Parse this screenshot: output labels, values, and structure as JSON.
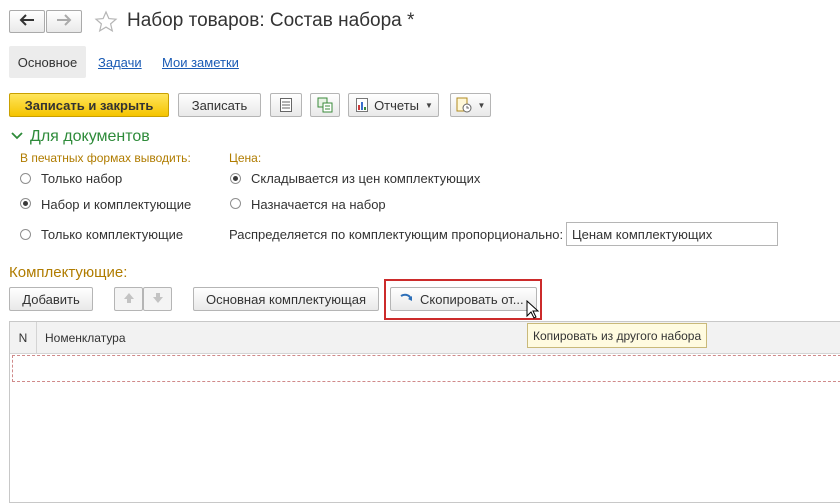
{
  "window": {
    "title": "Набор товаров: Состав набора *"
  },
  "nav": {
    "back_icon": "arrow-left-icon",
    "forward_icon": "arrow-right-icon",
    "favorite_icon": "star-icon"
  },
  "tabs": [
    {
      "label": "Основное",
      "active": true
    },
    {
      "label": "Задачи"
    },
    {
      "label": "Мои заметки"
    }
  ],
  "toolbar": {
    "save_close_label": "Записать и закрыть",
    "save_label": "Записать",
    "reports_label": "Отчеты"
  },
  "docs_section": {
    "title": "Для документов",
    "print_label": "В печатных формах выводить:",
    "print_options": [
      "Только набор",
      "Набор и комплектующие",
      "Только комплектующие"
    ],
    "print_selected": 1,
    "price_label": "Цена:",
    "price_options": [
      "Складывается из цен комплектующих",
      "Назначается на набор"
    ],
    "price_selected": 0,
    "distribute_label": "Распределяется по комплектующим пропорционально:",
    "distribute_value": "Ценам комплектующих"
  },
  "components": {
    "title": "Комплектующие:",
    "add_label": "Добавить",
    "main_component_label": "Основная комплектующая",
    "copy_label": "Скопировать от...",
    "tooltip": "Копировать из другого набора"
  },
  "table": {
    "columns": [
      "N",
      "Номенклатура"
    ]
  },
  "colors": {
    "accent_green": "#2e8b3a",
    "section_label": "#b07c00",
    "highlight_border": "#cc2b2b",
    "link": "#1a5bb5"
  }
}
